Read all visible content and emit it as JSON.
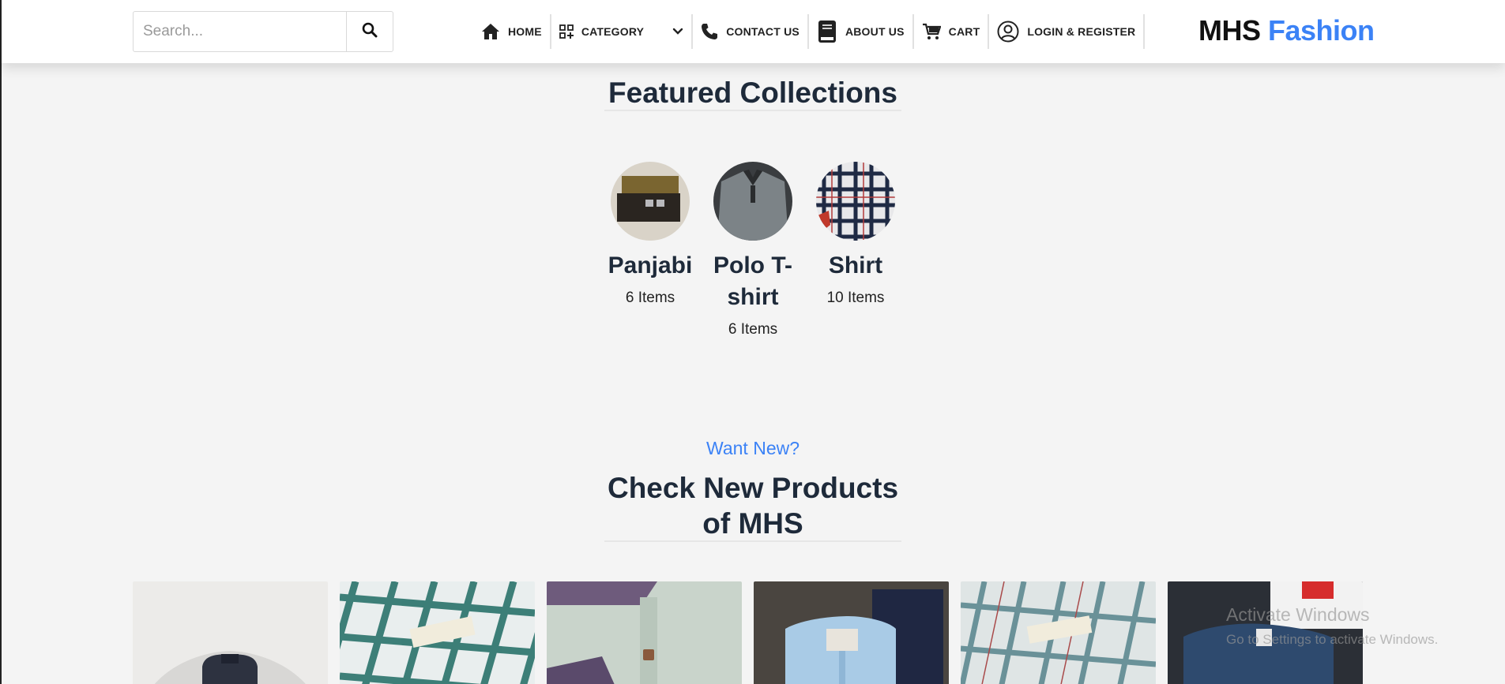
{
  "search": {
    "placeholder": "Search..."
  },
  "nav": {
    "home": "HOME",
    "category": "CATEGORY",
    "contact": "CONTACT US",
    "about": "ABOUT US",
    "cart": "CART",
    "login": "LOGIN & REGISTER"
  },
  "logo": {
    "part1": "MHS",
    "part2": "Fashion"
  },
  "featured": {
    "title": "Featured Collections",
    "collections": [
      {
        "name": "Panjabi",
        "count": "6 Items"
      },
      {
        "name": "Polo T-shirt",
        "count": "6 Items"
      },
      {
        "name": "Shirt",
        "count": "10 Items"
      }
    ]
  },
  "new_products": {
    "kicker": "Want New?",
    "title": "Check New Products of MHS"
  },
  "watermark": {
    "line1": "Activate Windows",
    "line2": "Go to Settings to activate Windows."
  },
  "colors": {
    "accent": "#3b82f6",
    "heading": "#1e2a3a",
    "background": "#f4f4f4"
  },
  "icons": [
    "search-icon",
    "home-icon",
    "category-icon",
    "chevron-down-icon",
    "phone-icon",
    "book-icon",
    "cart-icon",
    "user-circle-icon"
  ]
}
